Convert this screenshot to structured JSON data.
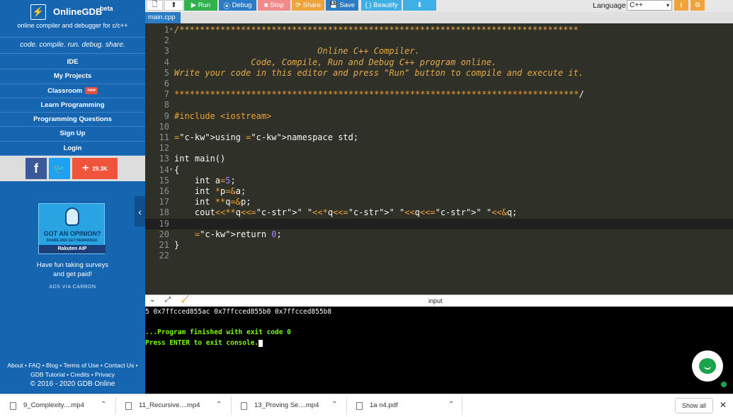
{
  "sidebar": {
    "brand_name": "OnlineGDB",
    "brand_badge": "beta",
    "brand_sub": "online compiler and debugger for c/c++",
    "tagline": "code. compile. run. debug. share.",
    "nav": [
      "IDE",
      "My Projects",
      "Classroom",
      "Learn Programming",
      "Programming Questions",
      "Sign Up",
      "Login"
    ],
    "classroom_badge": "new",
    "share_count": "29.3K",
    "ad": {
      "headline": "GOT AN OPINION?",
      "sub": "SHARE AND GET REWARDED.",
      "brand": "Rakuten AIP",
      "text_line1": "Have fun taking surveys",
      "text_line2": "and get paid!",
      "via": "ADS VIA CARBON"
    },
    "footer": {
      "line1": "About • FAQ • Blog • Terms of Use • Contact Us •",
      "line2": "GDB Tutorial • Credits • Privacy",
      "line3": "© 2016 - 2020 GDB Online"
    }
  },
  "toolbar": {
    "run": "Run",
    "debug": "Debug",
    "stop": "Stop",
    "share": "Share",
    "save": "Save",
    "beautify": "Beautify",
    "language_label": "Language",
    "language_value": "C++"
  },
  "tabs": [
    "main.cpp"
  ],
  "editor": {
    "active_line": 19,
    "lines": [
      "/******************************************************************************",
      "",
      "                            Online C++ Compiler.",
      "               Code, Compile, Run and Debug C++ program online.",
      "Write your code in this editor and press \"Run\" button to compile and execute it.",
      "",
      "*******************************************************************************/",
      "",
      "#include <iostream>",
      "",
      "using namespace std;",
      "",
      "int main()",
      "{",
      "    int a=5;",
      "    int *p=&a;",
      "    int **q=&p;",
      "    cout<<**q<<\" \"<<*q<<\" \"<<q<<\" \"<<&q;",
      "",
      "    return 0;",
      "}",
      ""
    ]
  },
  "console": {
    "input_label": "input",
    "output": "5 0x7ffcced855ac 0x7ffcced855b0 0x7ffcced855b8",
    "finished": "...Program finished with exit code 0",
    "press_enter": "Press ENTER to exit console."
  },
  "downloads": {
    "items": [
      "9_Complexity....mp4",
      "11_Recursive....mp4",
      "13_Proving Se....mp4",
      "1a n4.pdf"
    ],
    "show_all": "Show all"
  }
}
